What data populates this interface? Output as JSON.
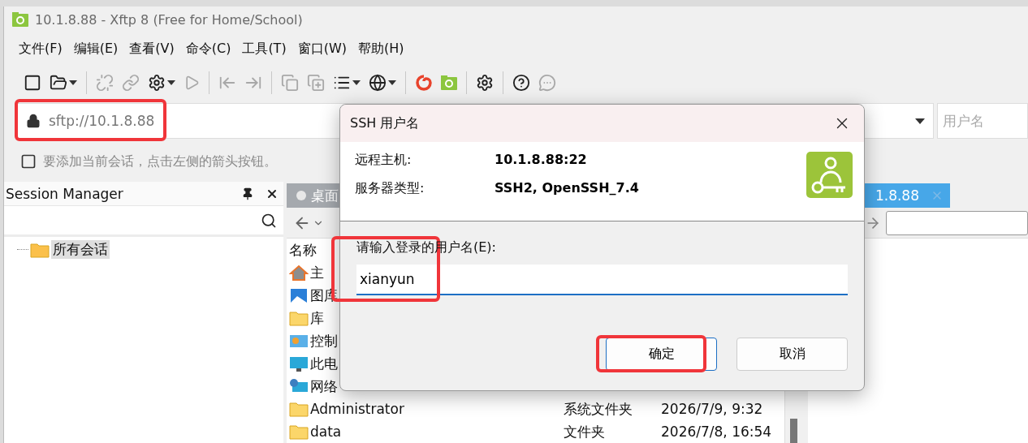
{
  "window": {
    "title": "10.1.8.88 - Xftp 8 (Free for Home/School)"
  },
  "menu": [
    "文件(F)",
    "编辑(E)",
    "查看(V)",
    "命令(C)",
    "工具(T)",
    "窗口(W)",
    "帮助(H)"
  ],
  "toolbar": [
    {
      "disabled": false,
      "dropdown": false
    },
    {
      "disabled": false,
      "dropdown": true
    },
    {
      "kind": "separator"
    },
    {
      "disabled": true,
      "dropdown": false
    },
    {
      "disabled": true,
      "dropdown": false
    },
    {
      "disabled": false,
      "dropdown": true
    },
    {
      "disabled": true,
      "dropdown": false
    },
    {
      "kind": "separator"
    },
    {
      "disabled": true,
      "dropdown": false
    },
    {
      "disabled": true,
      "dropdown": false
    },
    {
      "kind": "separator"
    },
    {
      "disabled": true,
      "dropdown": false
    },
    {
      "disabled": true,
      "dropdown": false
    },
    {
      "disabled": false,
      "dropdown": true
    },
    {
      "disabled": false,
      "dropdown": true
    },
    {
      "kind": "separator"
    },
    {
      "dropdown": false
    },
    {
      "dropdown": false
    },
    {
      "kind": "separator"
    },
    {
      "disabled": false,
      "dropdown": false
    },
    {
      "kind": "separator"
    },
    {
      "disabled": false,
      "dropdown": false
    },
    {
      "disabled": true,
      "dropdown": false
    }
  ],
  "address": {
    "value": "sftp://10.1.8.88",
    "username_placeholder": "用户名"
  },
  "hint": "要添加当前会话，点击左侧的箭头按钮。",
  "session_manager": {
    "title": "Session Manager",
    "tree": [
      {
        "label": "所有会话",
        "selected": true
      }
    ]
  },
  "local_pane": {
    "tab": "桌面",
    "column_header": "名称",
    "rows": [
      {
        "name": "主"
      },
      {
        "name": "图库"
      },
      {
        "name": "库"
      },
      {
        "name": "控制"
      },
      {
        "name": "此电"
      },
      {
        "name": "网络"
      },
      {
        "name": "Administrator",
        "type": "系统文件夹",
        "date": "2026/7/9, 9:32"
      },
      {
        "name": "data",
        "type": "文件夹",
        "date": "2026/7/8, 16:54"
      }
    ]
  },
  "remote_pane": {
    "tab": "1.8.88"
  },
  "dialog": {
    "title": "SSH 用户名",
    "info": [
      {
        "label": "远程主机:",
        "value": "10.1.8.88:22"
      },
      {
        "label": "服务器类型:",
        "value": "SSH2, OpenSSH_7.4"
      }
    ],
    "prompt": "请输入登录的用户名(E):",
    "value": "xianyun",
    "buttons": [
      {
        "label": "确定",
        "default": true
      },
      {
        "label": "取消",
        "default": false
      }
    ]
  }
}
